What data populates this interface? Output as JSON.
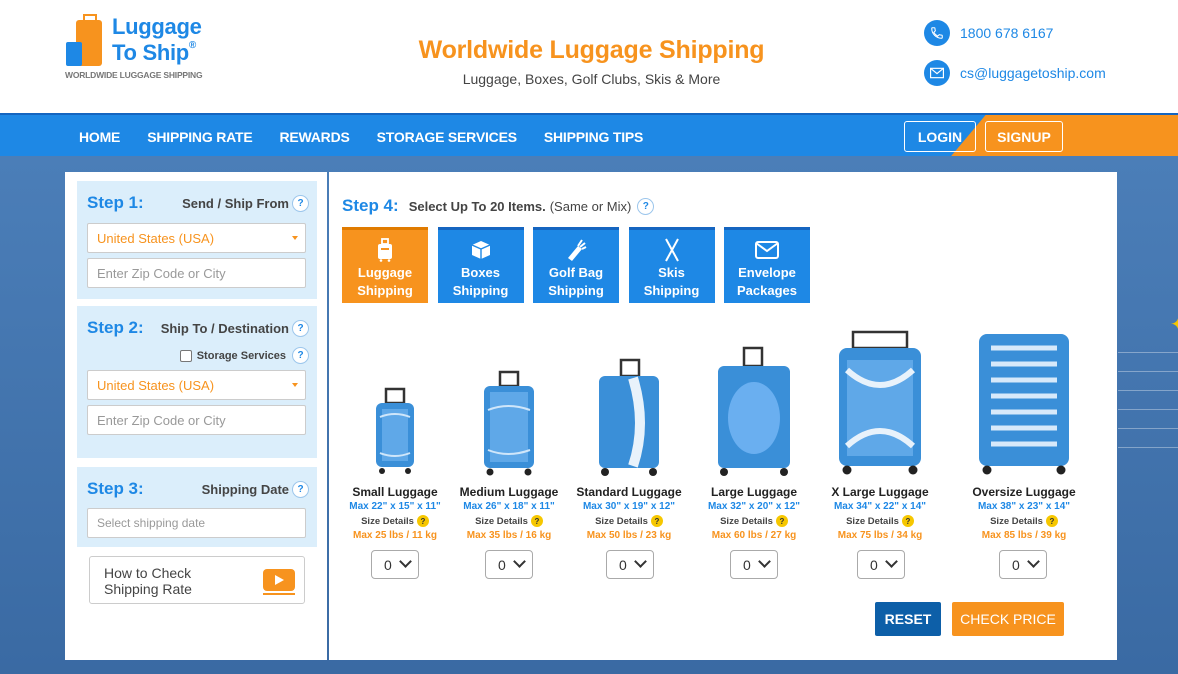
{
  "header": {
    "logo": {
      "line1": "Luggage",
      "line2": "To Ship",
      "reg": "®",
      "tagline": "WORLDWIDE LUGGAGE SHIPPING"
    },
    "title": "Worldwide Luggage Shipping",
    "subtitle": "Luggage, Boxes, Golf Clubs, Skis & More",
    "phone": "1800 678 6167",
    "email": "cs@luggagetoship.com"
  },
  "nav": {
    "items": [
      "HOME",
      "SHIPPING RATE",
      "REWARDS",
      "STORAGE SERVICES",
      "SHIPPING TIPS"
    ],
    "login": "LOGIN",
    "signup": "SIGNUP"
  },
  "steps": {
    "step1": {
      "label": "Step 1:",
      "title": "Send / Ship From",
      "country": "United States (USA)",
      "zip_placeholder": "Enter Zip Code or City"
    },
    "step2": {
      "label": "Step 2:",
      "title": "Ship To / Destination",
      "storage_label": "Storage Services",
      "country": "United States (USA)",
      "zip_placeholder": "Enter Zip Code or City"
    },
    "step3": {
      "label": "Step 3:",
      "title": "Shipping Date",
      "date_placeholder": "Select shipping date"
    },
    "howto": {
      "line1": "How to Check",
      "line2": "Shipping Rate"
    },
    "qmark": "?"
  },
  "step4": {
    "label": "Step 4:",
    "instruction": "Select Up To 20 Items.",
    "note": "(Same or Mix)",
    "tabs": [
      {
        "line1": "Luggage",
        "line2": "Shipping",
        "icon": "luggage-icon"
      },
      {
        "line1": "Boxes",
        "line2": "Shipping",
        "icon": "box-icon"
      },
      {
        "line1": "Golf Bag",
        "line2": "Shipping",
        "icon": "golf-bag-icon"
      },
      {
        "line1": "Skis",
        "line2": "Shipping",
        "icon": "skis-icon"
      },
      {
        "line1": "Envelope",
        "line2": "Packages",
        "icon": "envelope-icon"
      }
    ]
  },
  "items": [
    {
      "name": "Small Luggage",
      "dims": "Max 22\" x 15\" x 11\"",
      "size": "Size Details",
      "weight": "Max 25 lbs / 11 kg",
      "qty": "0"
    },
    {
      "name": "Medium Luggage",
      "dims": "Max 26\" x 18\" x 11\"",
      "size": "Size Details",
      "weight": "Max 35 lbs / 16 kg",
      "qty": "0"
    },
    {
      "name": "Standard Luggage",
      "dims": "Max 30\" x 19\" x 12\"",
      "size": "Size Details",
      "weight": "Max 50 lbs / 23 kg",
      "qty": "0"
    },
    {
      "name": "Large Luggage",
      "dims": "Max 32\" x 20\" x 12\"",
      "size": "Size Details",
      "weight": "Max 60 lbs / 27 kg",
      "qty": "0"
    },
    {
      "name": "X Large Luggage",
      "dims": "Max 34\" x 22\" x 14\"",
      "size": "Size Details",
      "weight": "Max 75 lbs / 34 kg",
      "qty": "0"
    },
    {
      "name": "Oversize Luggage",
      "dims": "Max 38\" x 23\" x 14\"",
      "size": "Size Details",
      "weight": "Max 85 lbs / 39 kg",
      "qty": "0"
    }
  ],
  "buttons": {
    "reset": "RESET",
    "check": "CHECK PRICE"
  },
  "colors": {
    "brand_blue": "#1e88e5",
    "brand_orange": "#f7931e",
    "dark_blue": "#0d5fa8"
  }
}
